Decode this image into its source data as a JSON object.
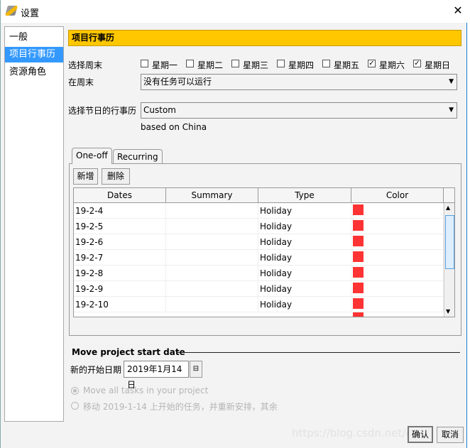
{
  "window": {
    "title": "设置",
    "close_icon": "close-icon",
    "app_icon": "pencil-app-icon"
  },
  "sidebar": {
    "items": [
      {
        "label": "一般"
      },
      {
        "label": "项目行事历",
        "selected": true
      },
      {
        "label": "资源角色"
      }
    ],
    "selected_color": "#3399ff"
  },
  "main": {
    "header": "项目行事历",
    "header_color": "#ffc700",
    "weekend_label": "选择周末",
    "weekdays": [
      {
        "label": "星期一",
        "checked": false
      },
      {
        "label": "星期二",
        "checked": false
      },
      {
        "label": "星期三",
        "checked": false
      },
      {
        "label": "星期四",
        "checked": false
      },
      {
        "label": "星期五",
        "checked": false
      },
      {
        "label": "星期六",
        "checked": true
      },
      {
        "label": "星期日",
        "checked": true
      }
    ],
    "on_weekend_label": "在周末",
    "on_weekend_value": "没有任务可以运行",
    "holiday_calendar_label": "选择节日的行事历",
    "holiday_calendar_value": "Custom",
    "based_on": "based on China",
    "tabs": [
      {
        "label": "One-off",
        "active": true
      },
      {
        "label": "Recurring"
      }
    ],
    "add_button": "新增",
    "delete_button": "删除",
    "table": {
      "columns": [
        "Dates",
        "Summary",
        "Type",
        "Color"
      ],
      "rows": [
        {
          "date": "19-2-4",
          "summary": "",
          "type": "Holiday",
          "color": "#ff3333"
        },
        {
          "date": "19-2-5",
          "summary": "",
          "type": "Holiday",
          "color": "#ff3333"
        },
        {
          "date": "19-2-6",
          "summary": "",
          "type": "Holiday",
          "color": "#ff3333"
        },
        {
          "date": "19-2-7",
          "summary": "",
          "type": "Holiday",
          "color": "#ff3333"
        },
        {
          "date": "19-2-8",
          "summary": "",
          "type": "Holiday",
          "color": "#ff3333"
        },
        {
          "date": "19-2-9",
          "summary": "",
          "type": "Holiday",
          "color": "#ff3333"
        },
        {
          "date": "19-2-10",
          "summary": "",
          "type": "Holiday",
          "color": "#ff3333"
        }
      ]
    },
    "move_section": {
      "title": "Move project start date",
      "new_start_label": "新的开始日期",
      "new_start_value": "2019年1月14日",
      "option_all": "Move all tasks in your project",
      "option_partial": "移动 2019-1-14 上开始的任务，并重新安排，其余",
      "selected_option": "all"
    }
  },
  "footer": {
    "ok": "确认",
    "cancel": "取消",
    "watermark": "https://blog.csdn.net/qq_"
  }
}
